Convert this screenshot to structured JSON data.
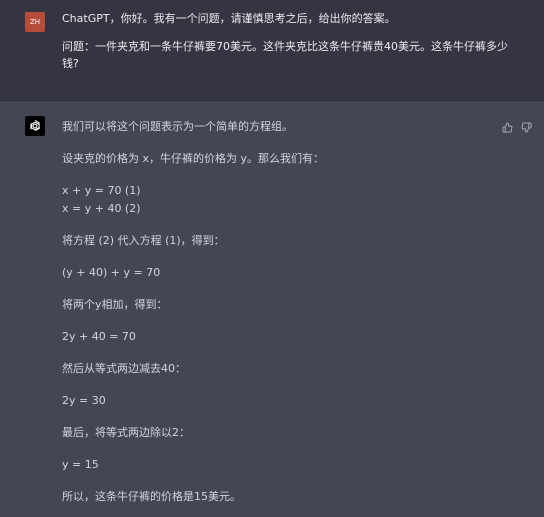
{
  "user_message": {
    "avatar_initials": "ZH",
    "paragraph_1": "ChatGPT，你好。我有一个问题，请谨慎思考之后，给出你的答案。",
    "paragraph_2": "问题：一件夹克和一条牛仔裤要70美元。这件夹克比这条牛仔裤贵40美元。这条牛仔裤多少钱?"
  },
  "assistant_message": {
    "lines": [
      "我们可以将这个问题表示为一个简单的方程组。",
      "设夹克的价格为 x，牛仔裤的价格为 y。那么我们有：",
      "x + y = 70 (1)",
      "x = y + 40 (2)",
      "将方程 (2) 代入方程 (1)，得到：",
      "(y + 40) + y = 70",
      "将两个y相加，得到：",
      "2y + 40 = 70",
      "然后从等式两边减去40：",
      "2y = 30",
      "最后，将等式两边除以2：",
      "y = 15",
      "所以，这条牛仔裤的价格是15美元。"
    ]
  },
  "icons": {
    "bot_avatar": "openai-logo-icon",
    "thumbs_up": "thumbs-up-icon",
    "thumbs_down": "thumbs-down-icon"
  },
  "colors": {
    "user_bg": "#343541",
    "assistant_bg": "#444654",
    "user_avatar": "#b84c3a",
    "text": "#d1d5db"
  }
}
